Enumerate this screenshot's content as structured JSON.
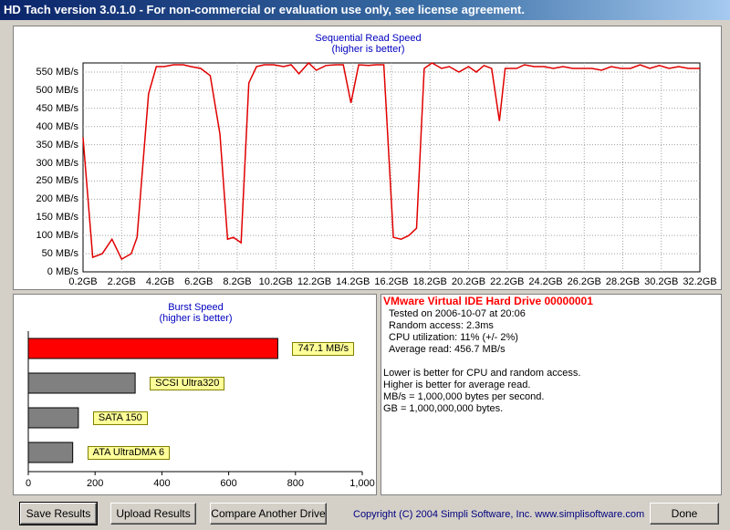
{
  "window": {
    "title": "HD Tach version 3.0.1.0  - For non-commercial or evaluation use only, see license agreement."
  },
  "read_chart": {
    "title": "Sequential Read Speed",
    "subtitle": "(higher is better)",
    "line_color": "#e00000",
    "y_ticks": [
      "0 MB/s",
      "50 MB/s",
      "100 MB/s",
      "150 MB/s",
      "200 MB/s",
      "250 MB/s",
      "300 MB/s",
      "350 MB/s",
      "400 MB/s",
      "450 MB/s",
      "500 MB/s",
      "550 MB/s"
    ],
    "x_ticks": [
      "0.2GB",
      "2.2GB",
      "4.2GB",
      "6.2GB",
      "8.2GB",
      "10.2GB",
      "12.2GB",
      "14.2GB",
      "16.2GB",
      "18.2GB",
      "20.2GB",
      "22.2GB",
      "24.2GB",
      "26.2GB",
      "28.2GB",
      "30.2GB",
      "32.2GB"
    ]
  },
  "chart_data": [
    {
      "type": "line",
      "title": "Sequential Read Speed",
      "subtitle": "(higher is better)",
      "xlabel": "",
      "ylabel": "",
      "xlim": [
        0.2,
        32.2
      ],
      "ylim": [
        0,
        575
      ],
      "grid": true,
      "x": [
        0.2,
        0.7,
        1.2,
        1.7,
        2.2,
        2.7,
        3.0,
        3.6,
        4.0,
        4.4,
        4.9,
        5.4,
        5.8,
        6.3,
        6.8,
        7.3,
        7.7,
        8.0,
        8.4,
        8.8,
        9.2,
        9.6,
        10.1,
        10.6,
        11.0,
        11.4,
        11.9,
        12.3,
        12.8,
        13.3,
        13.7,
        14.1,
        14.5,
        15.0,
        15.4,
        15.8,
        16.3,
        16.7,
        17.1,
        17.5,
        17.9,
        18.3,
        18.8,
        19.2,
        19.7,
        20.2,
        20.6,
        21.0,
        21.4,
        21.8,
        22.1,
        22.4,
        22.7,
        23.1,
        23.6,
        24.1,
        24.6,
        25.1,
        25.6,
        26.1,
        26.6,
        27.1,
        27.6,
        28.1,
        28.6,
        29.1,
        29.6,
        30.1,
        30.6,
        31.1,
        31.6,
        32.2
      ],
      "values": [
        370,
        40,
        50,
        90,
        35,
        50,
        95,
        490,
        565,
        565,
        570,
        570,
        565,
        560,
        540,
        380,
        90,
        95,
        80,
        520,
        565,
        570,
        570,
        565,
        570,
        545,
        575,
        555,
        568,
        570,
        570,
        465,
        570,
        568,
        570,
        570,
        95,
        90,
        100,
        120,
        560,
        575,
        560,
        565,
        550,
        565,
        550,
        568,
        560,
        415,
        560,
        560,
        560,
        570,
        565,
        565,
        560,
        565,
        560,
        560,
        560,
        555,
        565,
        560,
        560,
        570,
        560,
        568,
        560,
        565,
        560,
        560
      ]
    },
    {
      "type": "bar",
      "title": "Burst Speed",
      "subtitle": "(higher is better)",
      "orientation": "horizontal",
      "categories": [
        "747.1 MB/s",
        "SCSI Ultra320",
        "SATA 150",
        "ATA UltraDMA 6"
      ],
      "values": [
        747.1,
        320,
        150,
        133
      ],
      "colors": [
        "#ff0000",
        "#808080",
        "#808080",
        "#808080"
      ],
      "xlim": [
        0,
        1000
      ],
      "x_ticks": [
        "0",
        "200",
        "400",
        "600",
        "800",
        "1,000"
      ],
      "grid": false
    }
  ],
  "burst_chart": {
    "title": "Burst Speed",
    "subtitle": "(higher is better)",
    "labels": [
      "747.1 MB/s",
      "SCSI Ultra320",
      "SATA 150",
      "ATA UltraDMA 6"
    ],
    "x_ticks": [
      "0",
      "200",
      "400",
      "600",
      "800",
      "1,000"
    ]
  },
  "info": {
    "drive_name": "VMware Virtual IDE Hard Drive 00000001",
    "tested_on": "Tested on 2006-10-07 at 20:06",
    "random_access": "Random access: 2.3ms",
    "cpu_utilization": "CPU utilization: 11% (+/- 2%)",
    "average_read": "Average read: 456.7 MB/s",
    "note1": "Lower is better for CPU and random access.",
    "note2": "Higher is better for average read.",
    "note3": "MB/s = 1,000,000 bytes per second.",
    "note4": "GB = 1,000,000,000 bytes."
  },
  "buttons": {
    "save": "Save Results",
    "upload": "Upload Results",
    "compare": "Compare Another Drive",
    "done": "Done"
  },
  "copyright": "Copyright (C) 2004 Simpli Software, Inc. www.simplisoftware.com"
}
